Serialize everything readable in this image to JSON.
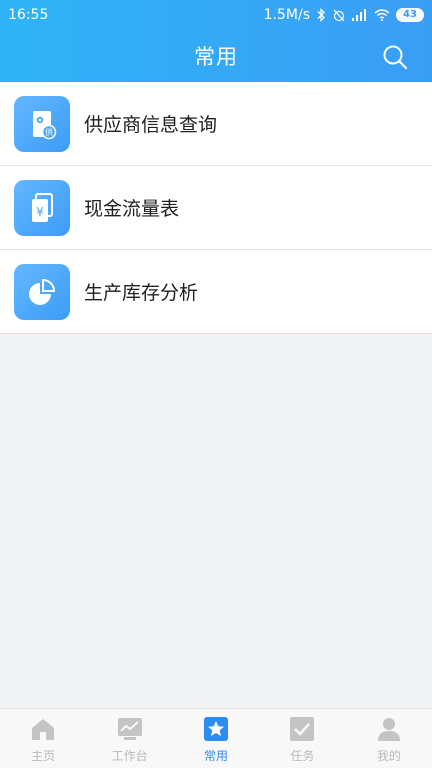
{
  "status_bar": {
    "time": "16:55",
    "network_speed": "1.5M/s",
    "battery": "43"
  },
  "header": {
    "title": "常用",
    "search_icon": "search-icon"
  },
  "list": {
    "items": [
      {
        "label": "供应商信息查询",
        "icon": "supplier-icon",
        "icon_text": "供"
      },
      {
        "label": "现金流量表",
        "icon": "cash-flow-icon",
        "icon_text": "¥"
      },
      {
        "label": "生产库存分析",
        "icon": "pie-chart-icon"
      }
    ]
  },
  "tabbar": {
    "tabs": [
      {
        "label": "主页",
        "icon": "home-icon",
        "active": false
      },
      {
        "label": "工作台",
        "icon": "workbench-icon",
        "active": false
      },
      {
        "label": "常用",
        "icon": "star-icon",
        "active": true
      },
      {
        "label": "任务",
        "icon": "task-check-icon",
        "active": false
      },
      {
        "label": "我的",
        "icon": "user-icon",
        "active": false
      }
    ]
  },
  "colors": {
    "header_gradient_start": "#2fb3f6",
    "header_gradient_end": "#3a9ef5",
    "active_tab": "#2d8cf0",
    "inactive_tab": "#b9b9b9",
    "icon_bg": "#4aa8f8"
  }
}
